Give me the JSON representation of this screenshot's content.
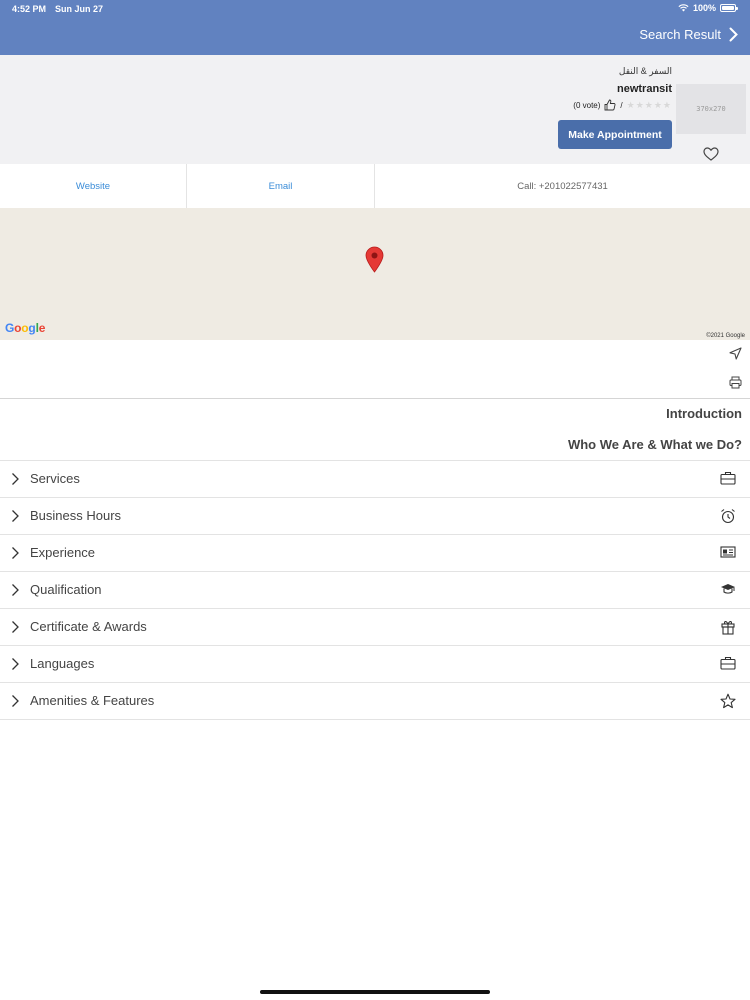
{
  "status_bar": {
    "time": "4:52 PM",
    "date": "Sun Jun 27",
    "battery": "100%"
  },
  "nav": {
    "back_result_label": "Search Result"
  },
  "profile": {
    "category": "السفر & النقل",
    "name": "newtransit",
    "votes": "(0 vote)",
    "separator": "/",
    "stars": "★★★★★",
    "image_placeholder": "370x270",
    "appointment_label": "Make Appointment"
  },
  "actions": {
    "website": "Website",
    "email": "Email",
    "call": "Call: +201022577431"
  },
  "map": {
    "provider": "Google",
    "copyright": "©2021 Google"
  },
  "intro": {
    "title": "Introduction",
    "subtitle": "Who We Are & What we Do?"
  },
  "sections": [
    {
      "label": "Services",
      "icon": "briefcase-icon"
    },
    {
      "label": "Business Hours",
      "icon": "alarm-clock-icon"
    },
    {
      "label": "Experience",
      "icon": "id-card-icon"
    },
    {
      "label": "Qualification",
      "icon": "graduation-cap-icon"
    },
    {
      "label": "Certificate & Awards",
      "icon": "gift-icon"
    },
    {
      "label": "Languages",
      "icon": "briefcase-icon"
    },
    {
      "label": "Amenities & Features",
      "icon": "star-icon"
    }
  ],
  "colors": {
    "header": "#6182c0",
    "button": "#4a6eaa",
    "link": "#3a8cd8",
    "pin": "#e53935"
  }
}
